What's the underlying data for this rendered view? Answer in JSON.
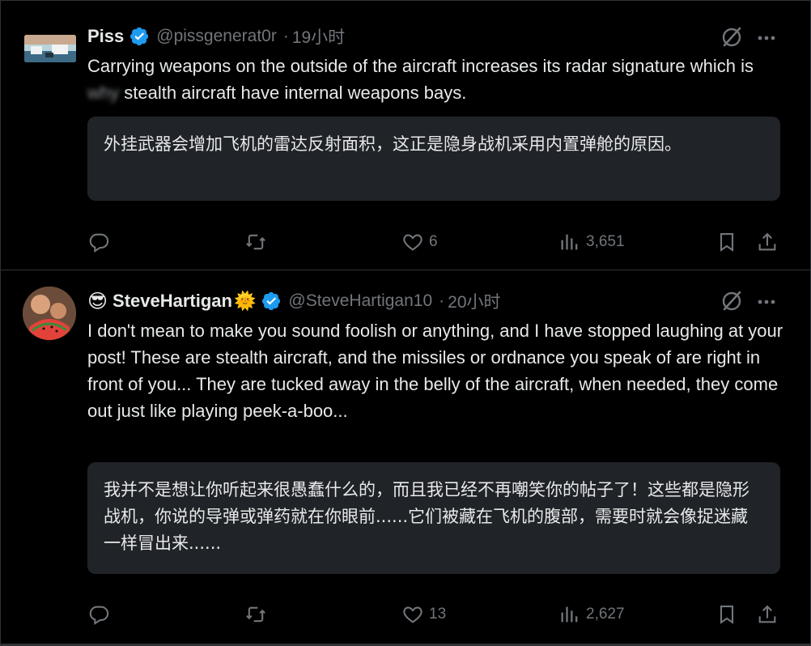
{
  "colors": {
    "background": "#000000",
    "text": "#e7e9ea",
    "muted": "#71767b",
    "verified": "#1d9bf0",
    "translation_bg": "#202327",
    "divider": "#2f3336"
  },
  "tweets": [
    {
      "author_name": "Piss",
      "verified": true,
      "handle": "@pissgenerat0r",
      "separator": "·",
      "time": "19小时",
      "text_before_blur": "Carrying weapons on the outside of the aircraft increases its radar signature which is ",
      "text_blurred": "why",
      "text_after_blur": " stealth aircraft have internal weapons bays.",
      "translation": "外挂武器会增加飞机的雷达反射面积，这正是隐身战机采用内置弹舱的原因。",
      "replies": "",
      "retweets": "",
      "likes": "6",
      "views": "3,651",
      "icons": [
        "reply-icon",
        "retweet-icon",
        "like-icon",
        "views-icon",
        "bookmark-icon",
        "share-icon",
        "grok-icon",
        "more-icon"
      ]
    },
    {
      "author_emoji_prefix": "😎",
      "author_name": "SteveHartigan",
      "author_emoji_suffix": "🌞",
      "verified": true,
      "handle": "@SteveHartigan10",
      "separator": "·",
      "time": "20小时",
      "text": "I don't mean to make you sound foolish or anything, and I have stopped laughing at your post! These are stealth aircraft, and the missiles or ordnance you speak of are right in front of you... They are tucked away in the belly of the aircraft, when needed, they come out just like playing peek-a-boo...",
      "translation": "我并不是想让你听起来很愚蠢什么的，而且我已经不再嘲笑你的帖子了！这些都是隐形战机，你说的导弹或弹药就在你眼前......它们被藏在飞机的腹部，需要时就会像捉迷藏一样冒出来......",
      "replies": "",
      "retweets": "",
      "likes": "13",
      "views": "2,627"
    }
  ]
}
